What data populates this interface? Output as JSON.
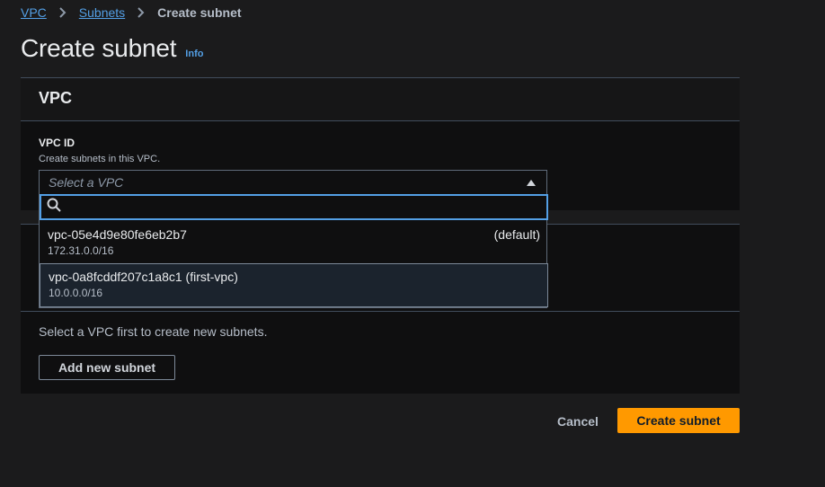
{
  "breadcrumb": {
    "items": [
      {
        "label": "VPC"
      },
      {
        "label": "Subnets"
      },
      {
        "label": "Create subnet"
      }
    ]
  },
  "page": {
    "title": "Create subnet",
    "info_label": "Info"
  },
  "vpc_section": {
    "heading": "VPC",
    "field_label": "VPC ID",
    "field_description": "Create subnets in this VPC.",
    "select_placeholder": "Select a VPC",
    "search_value": "",
    "options": [
      {
        "id": "vpc-05e4d9e80fe6eb2b7",
        "tag": "(default)",
        "cidr": "172.31.0.0/16"
      },
      {
        "id": "vpc-0a8fcddf207c1a8c1 (first-vpc)",
        "tag": "",
        "cidr": "10.0.0.0/16"
      }
    ]
  },
  "subnet_section": {
    "empty_text": "Select a VPC first to create new subnets.",
    "add_button": "Add new subnet"
  },
  "actions": {
    "cancel": "Cancel",
    "create": "Create subnet"
  },
  "colors": {
    "background": "#1b1b1c",
    "link": "#539fe5",
    "primary_button": "#ff9900"
  }
}
